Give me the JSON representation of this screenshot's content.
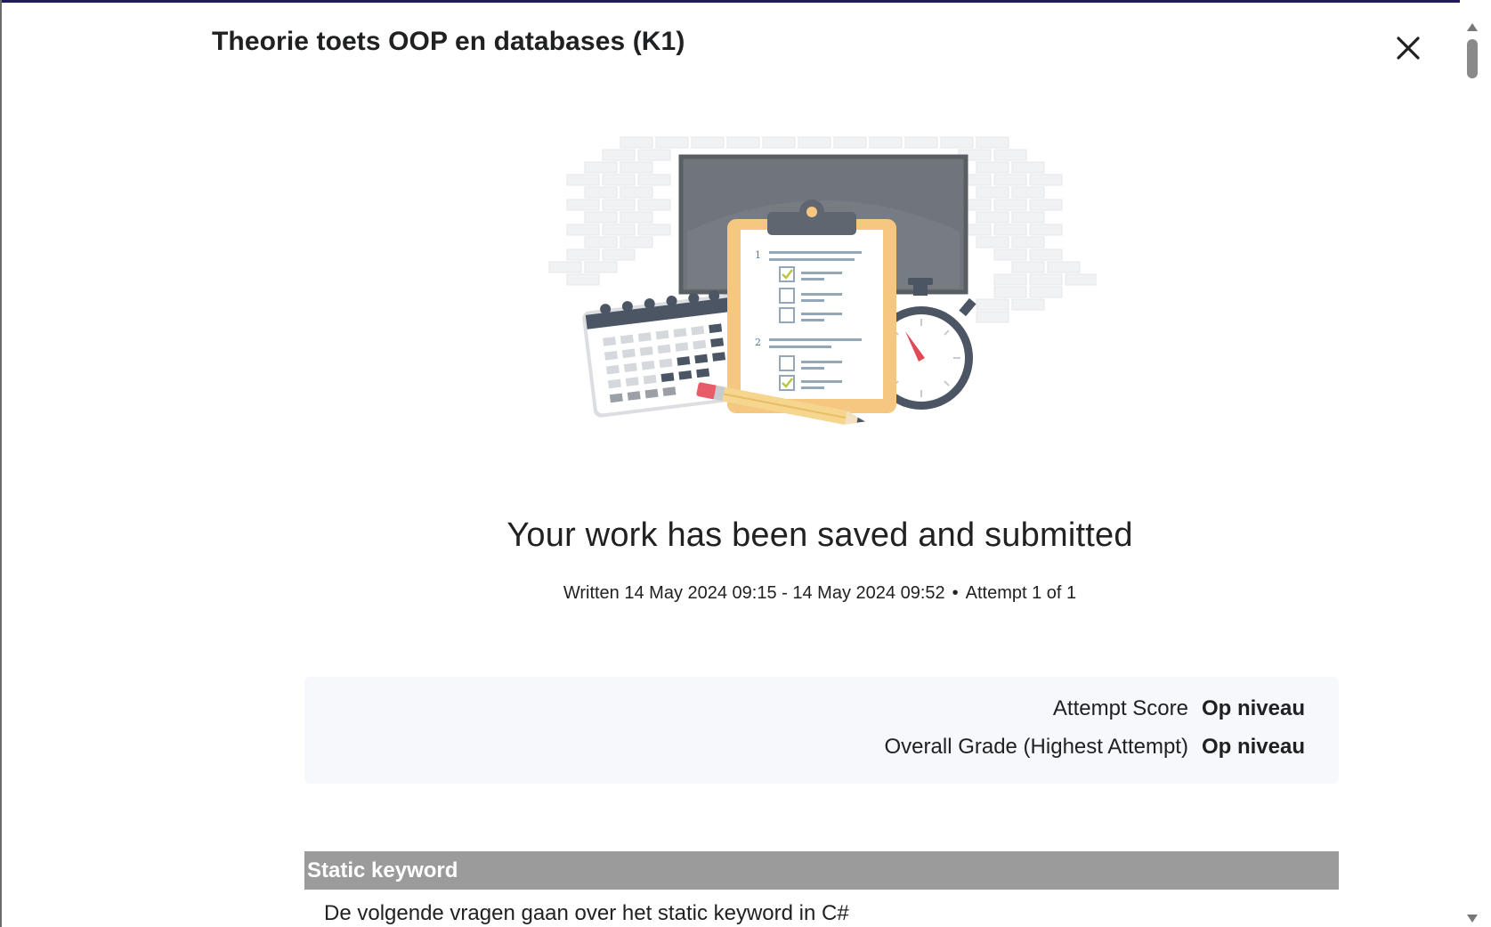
{
  "dialog": {
    "title": "Theorie toets OOP en databases (K1)",
    "close_icon": "close-icon"
  },
  "illustration": {
    "name": "quiz-submitted-illustration",
    "checklist_numbers": [
      "1",
      "2"
    ]
  },
  "confirmation": {
    "headline": "Your work has been saved and submitted",
    "written": "Written 14 May 2024 09:15 - 14 May 2024 09:52",
    "bullet": "•",
    "attempt": "Attempt 1 of 1"
  },
  "score": {
    "attempt_label": "Attempt Score",
    "attempt_value": "Op niveau",
    "overall_label": "Overall Grade (Highest Attempt)",
    "overall_value": "Op niveau"
  },
  "section": {
    "title": "Static keyword",
    "description": "De volgende vragen gaan over het static keyword in C#"
  },
  "colors": {
    "title_bar_border": "#1f1a5e",
    "section_header_bg": "#9b9b9b",
    "score_card_bg": "#f6f8fc"
  }
}
